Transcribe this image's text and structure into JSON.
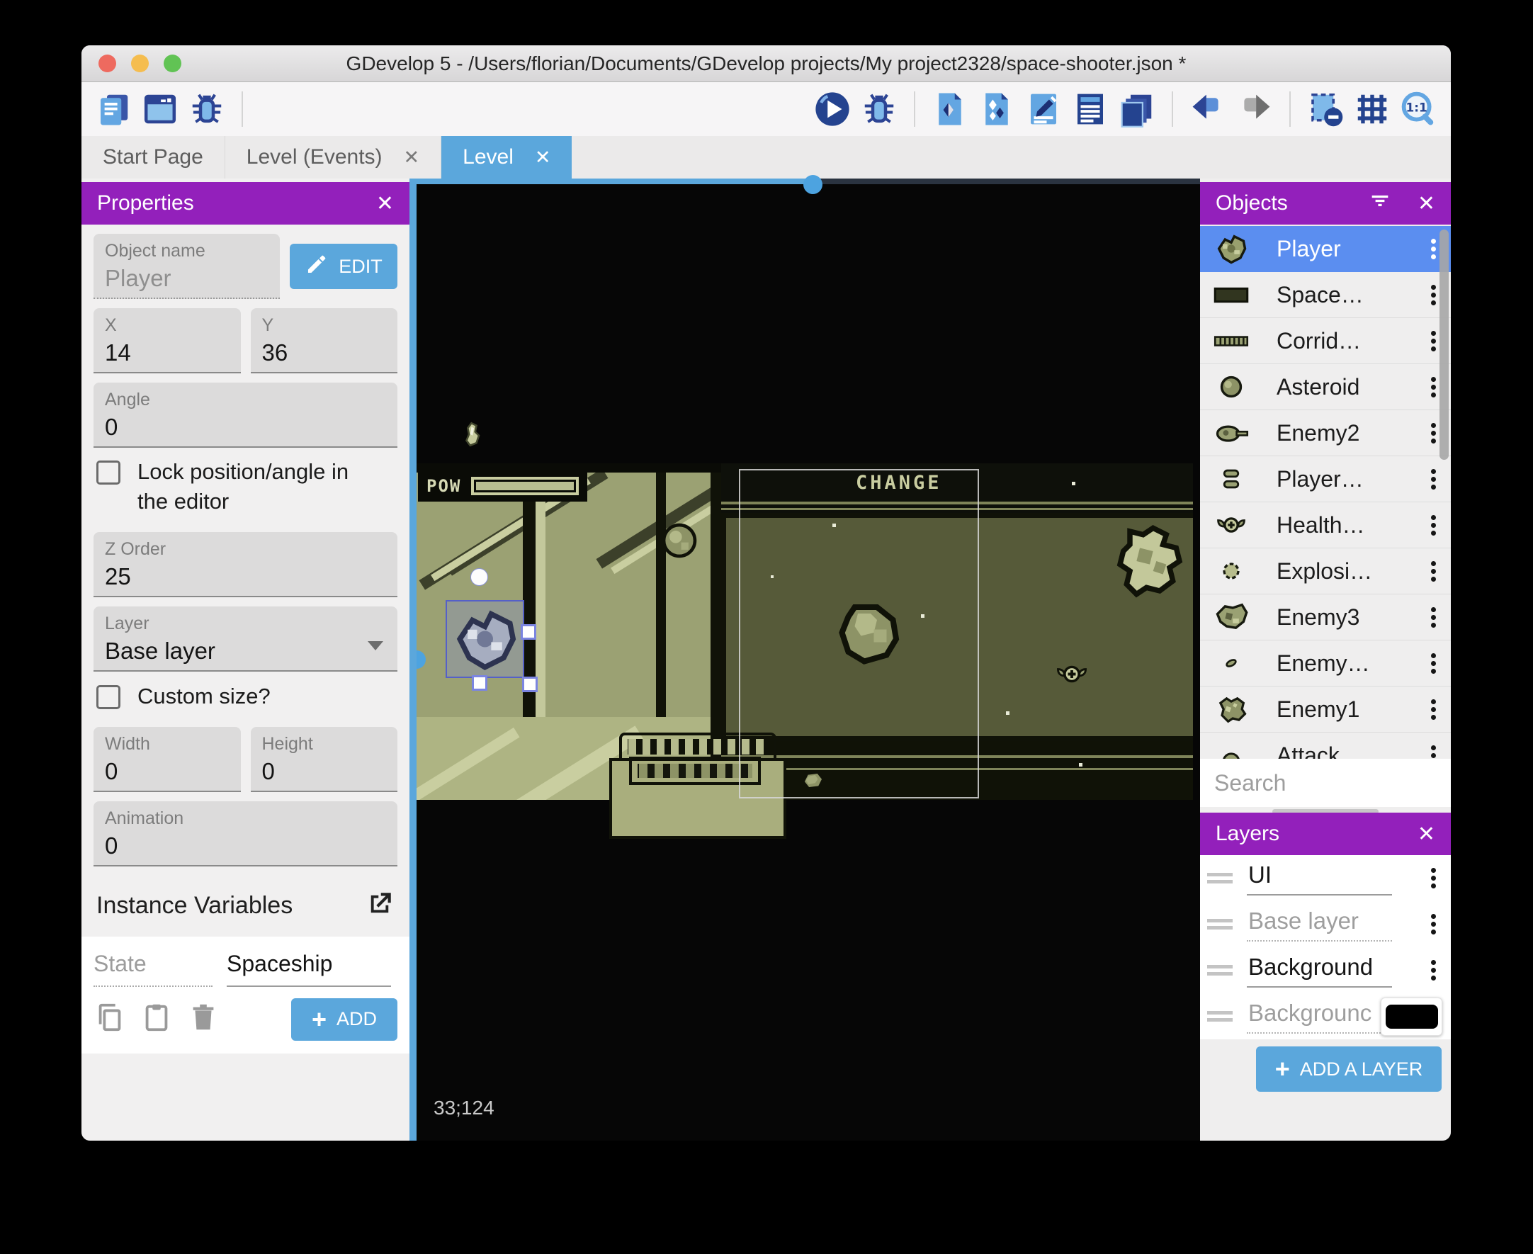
{
  "window": {
    "title": "GDevelop 5 - /Users/florian/Documents/GDevelop projects/My project2328/space-shooter.json *"
  },
  "tabs": [
    {
      "label": "Start Page",
      "active": false,
      "closable": false
    },
    {
      "label": "Level (Events)",
      "active": false,
      "closable": true
    },
    {
      "label": "Level",
      "active": true,
      "closable": true
    }
  ],
  "toolbar": {
    "left_groups": [
      [
        "project-manager",
        "preview-window",
        "debugger"
      ]
    ],
    "right_groups": [
      [
        "play",
        "debug"
      ],
      [
        "objects-editor",
        "object-groups",
        "scene-properties",
        "instances-list",
        "layers-editor"
      ],
      [
        "undo",
        "redo"
      ],
      [
        "window-mask",
        "grid",
        "zoom-1-1"
      ]
    ]
  },
  "properties": {
    "title": "Properties",
    "object_name_label": "Object name",
    "object_name": "Player",
    "edit_button": "EDIT",
    "x_label": "X",
    "x_value": "14",
    "y_label": "Y",
    "y_value": "36",
    "angle_label": "Angle",
    "angle_value": "0",
    "lock_checkbox_label": "Lock position/angle in the editor",
    "z_order_label": "Z Order",
    "z_order_value": "25",
    "layer_label": "Layer",
    "layer_value": "Base layer",
    "custom_size_label": "Custom size?",
    "width_label": "Width",
    "width_value": "0",
    "height_label": "Height",
    "height_value": "0",
    "animation_label": "Animation",
    "animation_value": "0",
    "instance_variables_title": "Instance Variables",
    "variables": [
      {
        "name": "State",
        "value": "Spaceship"
      }
    ],
    "add_button": "ADD"
  },
  "scene": {
    "hud_pow_label": "POW",
    "hud_change_label": "CHANGE",
    "cursor_coordinates": "33;124"
  },
  "objects_panel": {
    "title": "Objects",
    "search_placeholder": "Search",
    "items": [
      {
        "label": "Player",
        "icon": "player-ship",
        "selected": true
      },
      {
        "label": "Space…",
        "icon": "space-background",
        "selected": false
      },
      {
        "label": "Corrid…",
        "icon": "corridor",
        "selected": false
      },
      {
        "label": "Asteroid",
        "icon": "asteroid",
        "selected": false
      },
      {
        "label": "Enemy2",
        "icon": "enemy2-ship",
        "selected": false
      },
      {
        "label": "Player…",
        "icon": "player-bullets",
        "selected": false
      },
      {
        "label": "Health…",
        "icon": "health-pickup",
        "selected": false
      },
      {
        "label": "Explosi…",
        "icon": "explosion",
        "selected": false
      },
      {
        "label": "Enemy3",
        "icon": "enemy3-ship",
        "selected": false
      },
      {
        "label": "Enemy…",
        "icon": "enemy-bullet",
        "selected": false
      },
      {
        "label": "Enemy1",
        "icon": "enemy1-ship",
        "selected": false
      },
      {
        "label": "Attack…",
        "icon": "attack",
        "selected": false
      }
    ]
  },
  "layers_panel": {
    "title": "Layers",
    "add_button": "ADD A LAYER",
    "layers": [
      {
        "label": "UI",
        "muted": false,
        "underline": "solid",
        "trailing": "menu"
      },
      {
        "label": "Base layer",
        "muted": true,
        "underline": "dotted",
        "trailing": "menu"
      },
      {
        "label": "Background",
        "muted": false,
        "underline": "solid",
        "trailing": "menu"
      },
      {
        "label": "Backgrounc",
        "muted": true,
        "underline": "dotted",
        "trailing": "swatch",
        "swatch_color": "#000000"
      }
    ]
  },
  "colors": {
    "accent_purple": "#9320bb",
    "accent_blue": "#5ba7dc",
    "selection_blue": "#5b8ef0",
    "scene_olive_light": "#9ba173",
    "scene_olive_dark": "#565a39"
  }
}
